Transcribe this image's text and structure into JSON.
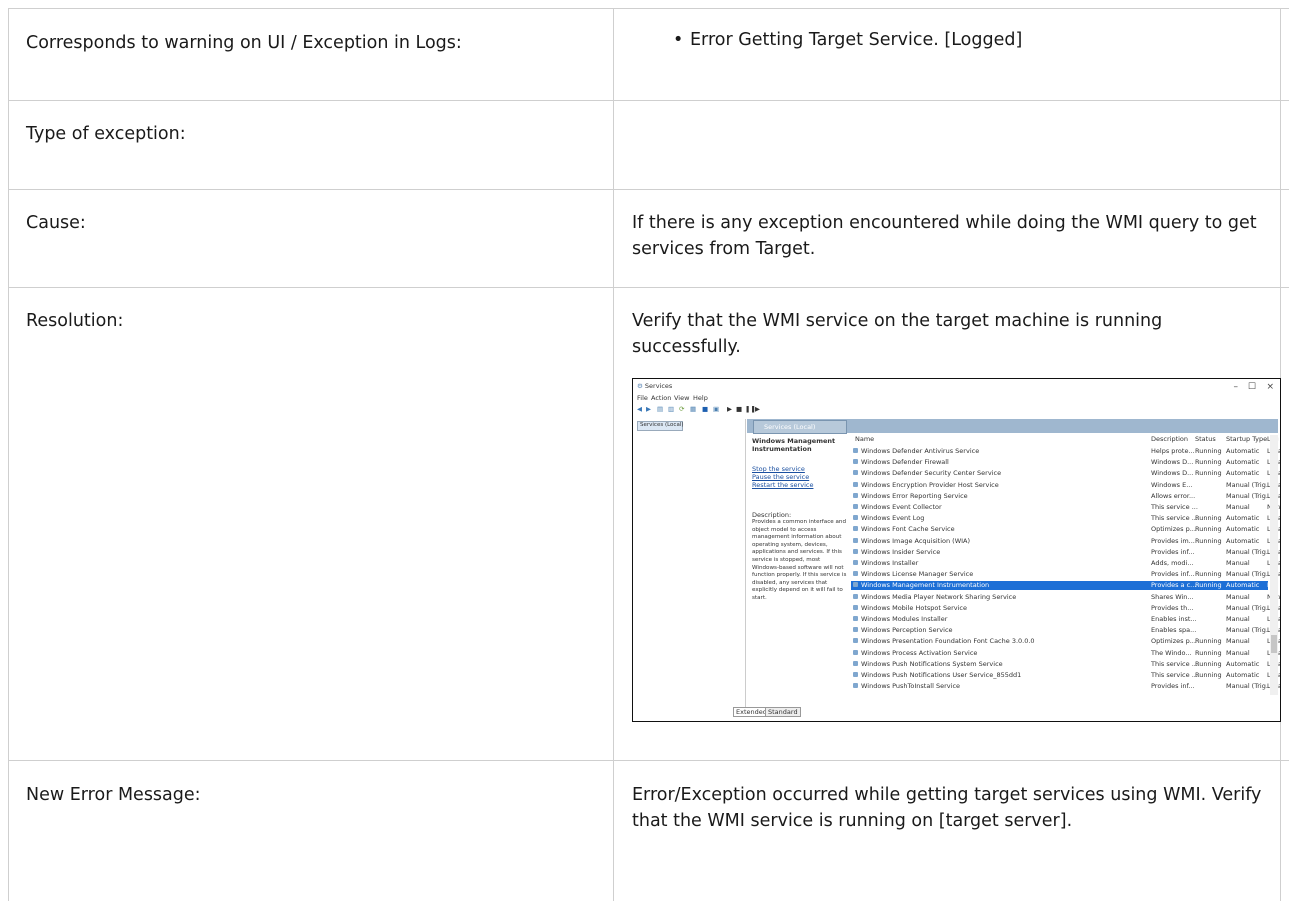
{
  "rows": [
    {
      "label": "Corresponds to warning on UI / Exception in Logs:",
      "bullet": "Error Getting Target Service. [Logged]"
    },
    {
      "label": "Type of exception:",
      "value": ""
    },
    {
      "label": "Cause:",
      "value": "If there is any exception encountered while doing the WMI query to get services from Target."
    },
    {
      "label": "Resolution:",
      "value": "Verify that the WMI service on the target machine is running successfully."
    },
    {
      "label": "New Error Message:",
      "value": "Error/Exception occurred while getting target services using WMI. Verify that the WMI service is running on [target server]."
    }
  ],
  "screenshot": {
    "title": "Services",
    "menu": [
      "File",
      "Action",
      "View",
      "Help"
    ],
    "left_node": "Services (Local)",
    "tab_header": "Services (Local)",
    "selected_title": "Windows Management Instrumentation",
    "actions": [
      "Stop the service",
      "Pause the service",
      "Restart the service"
    ],
    "description_label": "Description:",
    "description": "Provides a common interface and object model to access management information about operating system, devices, applications and services. If this service is stopped, most Windows-based software will not function properly. If this service is disabled, any services that explicitly depend on it will fail to start.",
    "columns": [
      "Name",
      "Description",
      "Status",
      "Startup Type",
      "Log On As"
    ],
    "services": [
      [
        "Windows Defender Antivirus Service",
        "Helps prote...",
        "Running",
        "Automatic",
        "Local Syste"
      ],
      [
        "Windows Defender Firewall",
        "Windows D...",
        "Running",
        "Automatic",
        "Local Service"
      ],
      [
        "Windows Defender Security Center Service",
        "Windows D...",
        "Running",
        "Automatic",
        "Local Syste"
      ],
      [
        "Windows Encryption Provider Host Service",
        "Windows E...",
        "",
        "Manual (Trig...",
        "Local Service"
      ],
      [
        "Windows Error Reporting Service",
        "Allows error...",
        "",
        "Manual (Trig...",
        "Local Syste"
      ],
      [
        "Windows Event Collector",
        "This service ...",
        "",
        "Manual",
        "Network S..."
      ],
      [
        "Windows Event Log",
        "This service ...",
        "Running",
        "Automatic",
        "Local Service"
      ],
      [
        "Windows Font Cache Service",
        "Optimizes p...",
        "Running",
        "Automatic",
        "Local Service"
      ],
      [
        "Windows Image Acquisition (WIA)",
        "Provides im...",
        "Running",
        "Automatic",
        "Local Service"
      ],
      [
        "Windows Insider Service",
        "Provides inf...",
        "",
        "Manual (Trig...",
        "Local Syste"
      ],
      [
        "Windows Installer",
        "Adds, modi...",
        "",
        "Manual",
        "Local Syste"
      ],
      [
        "Windows License Manager Service",
        "Provides inf...",
        "Running",
        "Manual (Trig...",
        "Local Service"
      ],
      [
        "Windows Management Instrumentation",
        "Provides a c...",
        "Running",
        "Automatic",
        "Local Syste"
      ],
      [
        "Windows Media Player Network Sharing Service",
        "Shares Win...",
        "",
        "Manual",
        "Network S..."
      ],
      [
        "Windows Mobile Hotspot Service",
        "Provides th...",
        "",
        "Manual (Trig...",
        "Local Service"
      ],
      [
        "Windows Modules Installer",
        "Enables inst...",
        "",
        "Manual",
        "Local Syste"
      ],
      [
        "Windows Perception Service",
        "Enables spa...",
        "",
        "Manual (Trig...",
        "Local Service"
      ],
      [
        "Windows Presentation Foundation Font Cache 3.0.0.0",
        "Optimizes p...",
        "Running",
        "Manual",
        "Local Service"
      ],
      [
        "Windows Process Activation Service",
        "The Windo...",
        "Running",
        "Manual",
        "Local Syste"
      ],
      [
        "Windows Push Notifications System Service",
        "This service ...",
        "Running",
        "Automatic",
        "Local Syste"
      ],
      [
        "Windows Push Notifications User Service_855dd1",
        "This service ...",
        "Running",
        "Automatic",
        "Local Syste"
      ],
      [
        "Windows PushToInstall Service",
        "Provides inf...",
        "",
        "Manual (Trig...",
        "Local Syste"
      ]
    ],
    "selected_index": 12,
    "bottom_tabs": [
      "Extended",
      "Standard"
    ]
  }
}
